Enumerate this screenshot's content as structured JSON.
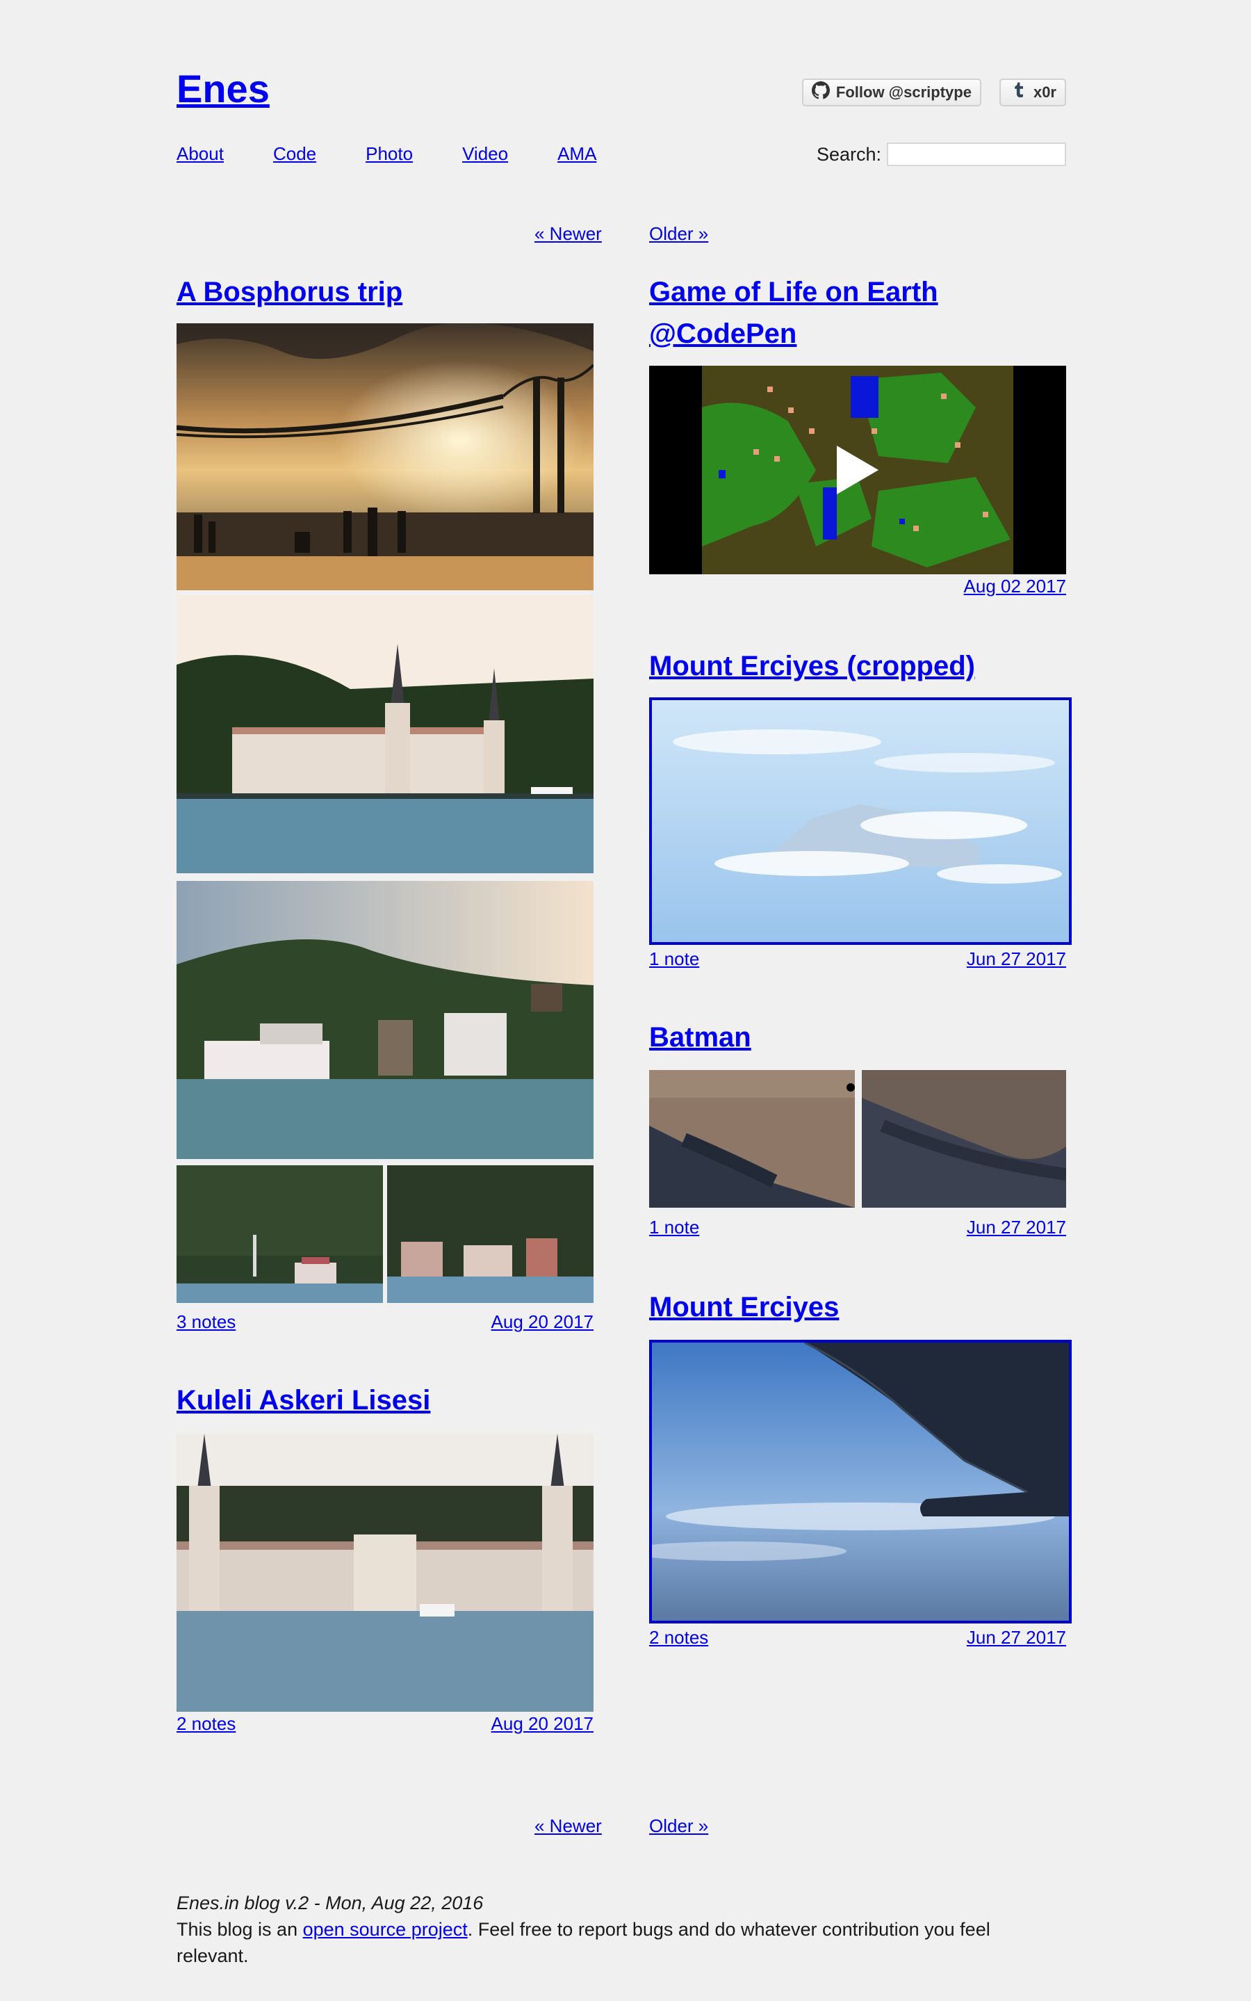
{
  "header": {
    "title": "Enes",
    "buttons": [
      {
        "icon": "github-icon",
        "label": "Follow @scriptype"
      },
      {
        "icon": "tumblr-icon",
        "label": "x0r"
      }
    ]
  },
  "nav": {
    "items": [
      "About",
      "Code",
      "Photo",
      "Video",
      "AMA"
    ]
  },
  "search": {
    "label": "Search:",
    "value": "",
    "placeholder": ""
  },
  "pager_top": {
    "newer": "« Newer",
    "older": "Older »"
  },
  "pager_bottom": {
    "newer": "« Newer",
    "older": "Older »"
  },
  "posts_left": [
    {
      "title": "A Bosphorus trip",
      "notes": "3 notes",
      "date": "Aug 20 2017"
    },
    {
      "title": "Kuleli Askeri Lisesi",
      "notes": "2 notes",
      "date": "Aug 20 2017"
    }
  ],
  "posts_right": [
    {
      "title_line1": "Game of Life on Earth",
      "title_line2": "@CodePen",
      "date": "Aug 02 2017"
    },
    {
      "title": "Mount Erciyes (cropped)",
      "notes": "1 note",
      "date": "Jun 27 2017"
    },
    {
      "title": "Batman",
      "notes": "1 note",
      "date": "Jun 27 2017"
    },
    {
      "title": "Mount Erciyes",
      "notes": "2 notes",
      "date": "Jun 27 2017"
    }
  ],
  "footer": {
    "version": "Enes.in blog v.2 - Mon, Aug 22, 2016",
    "text_before": "This blog is an ",
    "link": "open source project",
    "text_after": ". Feel free to report bugs and do whatever contribution you feel relevant."
  },
  "colors": {
    "link": "#0000ee",
    "background": "#f0f0f0",
    "photo_border": "#0000cc"
  }
}
